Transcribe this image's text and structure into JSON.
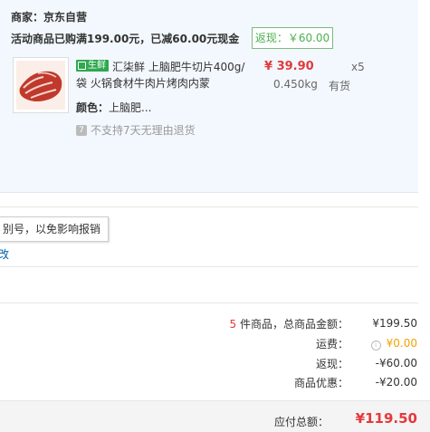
{
  "vendor": {
    "label": "商家：",
    "name": "京东自营"
  },
  "promotion": {
    "text": "活动商品已购满199.00元，已减60.00元现金",
    "rebate": "返现：￥60.00"
  },
  "product": {
    "tag": "生鲜",
    "title": "汇柒鲜 上脑肥牛切片400g/袋 火锅食材牛肉片烤肉内蒙",
    "price": "¥ 39.90",
    "quantity": "x5",
    "weight": "0.450kg",
    "stock": "有货",
    "color_label": "颜色：",
    "color_value": "上脑肥...",
    "no_return_icon": "7",
    "no_return_text": "不支持7天无理由退货"
  },
  "tooltip": "别号，以免影响报销",
  "partial_link": "改",
  "summary": {
    "count": "5",
    "count_suffix": " 件商品，总商品金额：",
    "items_total": "¥199.50",
    "shipping_label": "运费：",
    "shipping_value": "¥0.00",
    "rebate_label": "返现：",
    "rebate_value": "-¥60.00",
    "discount_label": "商品优惠：",
    "discount_value": "-¥20.00"
  },
  "total": {
    "label": "应付总额：",
    "value": "¥119.50"
  },
  "colors": {
    "price_red": "#e4393c",
    "rebate_green": "#4caf50",
    "panel_bg": "#f3f8fe",
    "shipping_orange": "#f0a300"
  },
  "icons": [
    "product-thumbnail",
    "fresh-tag-icon",
    "no-return-icon",
    "info-icon"
  ]
}
